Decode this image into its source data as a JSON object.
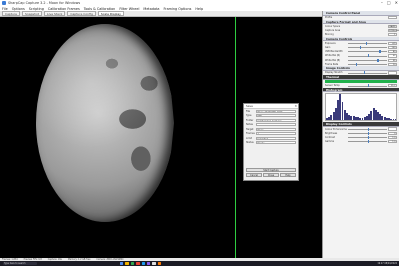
{
  "window": {
    "title": "SharpCap Capture 3.2 - Moon for Windows",
    "controls": [
      "–",
      "□",
      "✕"
    ]
  },
  "menu": [
    "File",
    "Options",
    "Scripting",
    "Calibration Frames",
    "Tools & Calibration",
    "Filter Wheel",
    "Metadata",
    "Framing Options",
    "Help"
  ],
  "toolbar": {
    "buttons": [
      "Capture",
      "Snapshot",
      "Live Stack",
      "Capture Config",
      "Scale Display"
    ],
    "active": "Scale Display"
  },
  "dialog": {
    "title": "Save",
    "rows": [
      {
        "label": "File",
        "value": "Moon_20220408_1927"
      },
      {
        "label": "Type",
        "value": "PNG"
      },
      {
        "label": "Folder",
        "value": "C:\\SharpCap Captures"
      },
      {
        "label": "Notes",
        "value": ""
      },
      {
        "label": "Target",
        "value": "Moon"
      },
      {
        "label": "Frames",
        "value": "1"
      },
      {
        "label": "Limit",
        "value": "Unlimited"
      },
      {
        "label": "Status",
        "value": "Ready"
      }
    ],
    "main_button": "Start Capture",
    "buttons": [
      "Cancel",
      "Close",
      "Help"
    ]
  },
  "panel": {
    "sections": [
      {
        "title": "Camera Control Panel",
        "dark": false,
        "rows": [
          {
            "label": "Profile",
            "value": ""
          }
        ]
      },
      {
        "title": "Capture Format and Area",
        "dark": false,
        "rows": [
          {
            "label": "Colour Space",
            "value": "RAW8"
          },
          {
            "label": "Capture Area",
            "value": "3096x2080"
          },
          {
            "label": "Binning",
            "value": "1"
          }
        ]
      },
      {
        "title": "Camera Controls",
        "dark": false,
        "rows": [
          {
            "label": "Exposure",
            "value": "4.9",
            "pos": 0.45
          },
          {
            "label": "Gain",
            "value": "100",
            "pos": 0.3
          },
          {
            "label": "USB Bandwidth",
            "value": "80",
            "pos": 0.8
          },
          {
            "label": "White Bal (R)",
            "value": "52",
            "pos": 0.5
          },
          {
            "label": "White Bal (B)",
            "value": "95",
            "pos": 0.75
          },
          {
            "label": "Frame Rate",
            "value": "10",
            "pos": 0.2
          }
        ]
      },
      {
        "title": "Image Controls",
        "dark": false,
        "rows": [
          {
            "label": "Display Stretch",
            "value": "",
            "pos": 0.4
          }
        ]
      },
      {
        "title": "Thermal",
        "dark": true,
        "rows": [
          {
            "label": "Sensor Temp",
            "value": "25.2",
            "pos": 0.5
          }
        ]
      },
      {
        "title": "Histogram",
        "dark": true,
        "rows": []
      },
      {
        "title": "Display Controls",
        "dark": true,
        "rows": [
          {
            "label": "Colour Enhancement",
            "value": "",
            "pos": 0.5
          },
          {
            "label": "Brightness",
            "value": "0",
            "pos": 0.5
          },
          {
            "label": "Contrast",
            "value": "1.0",
            "pos": 0.5
          },
          {
            "label": "Gamma",
            "value": "1.0",
            "pos": 0.5
          }
        ]
      }
    ],
    "histogram": [
      2,
      3,
      5,
      8,
      12,
      20,
      26,
      18,
      10,
      7,
      5,
      4,
      4,
      3,
      3,
      2,
      2,
      3,
      4,
      6,
      9,
      12,
      10,
      8,
      6,
      4,
      3,
      2,
      2,
      1,
      1,
      1
    ]
  },
  "status": {
    "items": [
      "Frames: 1,834",
      "Preview FPS: 9.8",
      "Capture: Idle",
      "Memory: 1.2 GB free",
      "Camera: ZWO ASI294MC"
    ]
  },
  "taskbar": {
    "search": "Type here to search",
    "time": "19:27  08/04/2022",
    "icon_colors": [
      "#4e8ef7",
      "#f5b400",
      "#2fa84f",
      "#e94235",
      "#1c9bf0",
      "#8a5cf6",
      "#e0e0e0",
      "#ff7a00"
    ]
  }
}
